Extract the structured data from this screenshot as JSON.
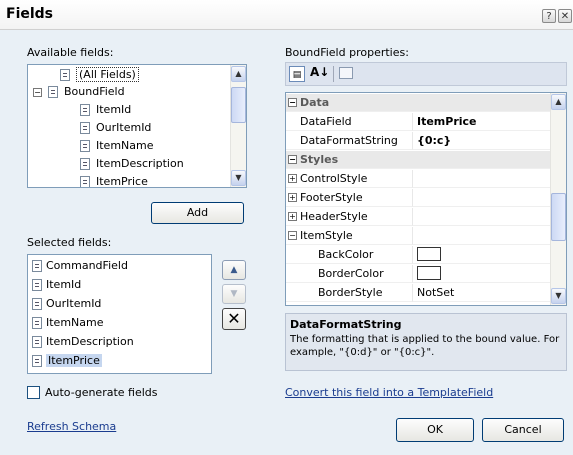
{
  "window": {
    "title": "Fields",
    "help_glyph": "?",
    "close_glyph": "✕"
  },
  "available": {
    "label": "Available fields:",
    "items": [
      "(All Fields)",
      "BoundField",
      "ItemId",
      "OurItemId",
      "ItemName",
      "ItemDescription",
      "ItemPrice"
    ],
    "add_label": "Add"
  },
  "selected": {
    "label": "Selected fields:",
    "items": [
      "CommandField",
      "ItemId",
      "OurItemId",
      "ItemName",
      "ItemDescription",
      "ItemPrice"
    ],
    "selected_item": "ItemPrice",
    "delete_glyph": "✕"
  },
  "autogen": {
    "label": "Auto-generate fields",
    "checked": false
  },
  "refresh_label": "Refresh Schema",
  "properties": {
    "label": "BoundField properties:",
    "rows": [
      {
        "name": "Data",
        "value": "",
        "kind": "category",
        "expander": "−"
      },
      {
        "name": "DataField",
        "value": "ItemPrice",
        "kind": "prop",
        "bold": true
      },
      {
        "name": "DataFormatString",
        "value": "{0:c}",
        "kind": "prop",
        "bold": true
      },
      {
        "name": "Styles",
        "value": "",
        "kind": "category",
        "expander": "−"
      },
      {
        "name": "ControlStyle",
        "value": "",
        "kind": "expand",
        "expander": "+"
      },
      {
        "name": "FooterStyle",
        "value": "",
        "kind": "expand",
        "expander": "+"
      },
      {
        "name": "HeaderStyle",
        "value": "",
        "kind": "expand",
        "expander": "+"
      },
      {
        "name": "ItemStyle",
        "value": "",
        "kind": "expand",
        "expander": "−"
      },
      {
        "name": "BackColor",
        "value": "",
        "kind": "sub",
        "swatch": true
      },
      {
        "name": "BorderColor",
        "value": "",
        "kind": "sub",
        "swatch": true
      },
      {
        "name": "BorderStyle",
        "value": "NotSet",
        "kind": "sub"
      }
    ]
  },
  "description": {
    "title": "DataFormatString",
    "text": "The formatting that is applied to the bound value. For example, \"{0:d}\" or \"{0:c}\"."
  },
  "convert_label": "Convert this field into a TemplateField",
  "ok_label": "OK",
  "cancel_label": "Cancel"
}
